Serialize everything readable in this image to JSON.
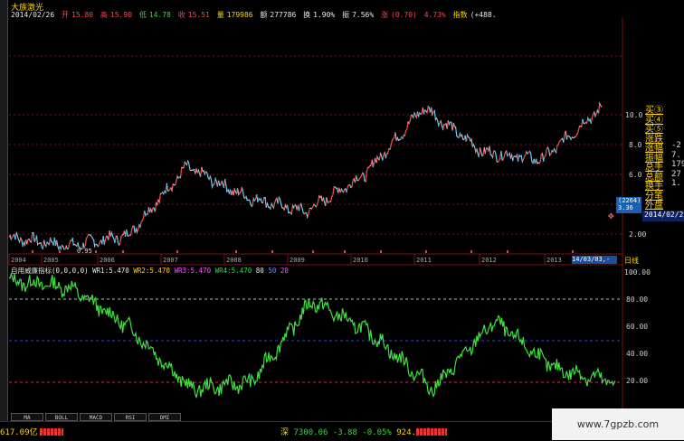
{
  "stock": {
    "name": "大族激光",
    "date": "2014/02/26",
    "open_label": "开",
    "open": "15.80",
    "high_label": "高",
    "high": "15.90",
    "low_label": "低",
    "low": "14.78",
    "close_label": "收",
    "close": "15.51",
    "volume_label": "量",
    "volume": "179986",
    "amount_label": "额",
    "amount": "277786",
    "turnover_label": "换",
    "turnover": "1.90%",
    "amplitude_label": "振",
    "amplitude": "7.56%",
    "change_label": "涨",
    "change": "(0.70)",
    "change_pct": "4.73%",
    "index_label": "指数",
    "index_val": "(+488."
  },
  "price_axis": [
    "10.00",
    "8.00",
    "6.00",
    "4.00",
    "2.00"
  ],
  "price_box": {
    "line1": "(2264)",
    "line2": "3.36"
  },
  "low_marker": "0.95",
  "years": [
    "2004",
    "2005",
    "2006",
    "2007",
    "2008",
    "2009",
    "2010",
    "2011",
    "2012",
    "2013"
  ],
  "date_cursor": "14/03/03,-",
  "period_label": "日线",
  "right_panel": {
    "items": [
      "买③",
      "买④",
      "买⑤",
      "涨跌",
      "涨幅",
      "振幅",
      "总手",
      "总额",
      "换手",
      "分笔",
      "外盘"
    ],
    "values": [
      "",
      "",
      "",
      "",
      "-2",
      "7.",
      "179",
      "27",
      "1.",
      "",
      ""
    ],
    "date": "2014/02/2"
  },
  "indicator": {
    "name": "自用威廉指标",
    "params": "(0,0,0,0)",
    "wr1": "WR1:5.470",
    "wr2": "WR2:5.470",
    "wr3": "WR3:5.470",
    "wr4": "WR4:5.470",
    "lv80": "80",
    "lv50": "50",
    "lv20": "20"
  },
  "osc_axis": [
    "100.00",
    "80.00",
    "60.00",
    "40.00",
    "20.00"
  ],
  "tabs": [
    "MA",
    "BOLL",
    "MACD",
    "RSI",
    "DMI"
  ],
  "status": {
    "left_amount": "617.09亿",
    "index_name": "深",
    "index_value": "7300.06",
    "index_change": "-3.88",
    "index_pct": "-0.05%",
    "index_amount": "924.92亿"
  },
  "watermark": "www.7gpzb.com",
  "chart_data": [
    {
      "type": "line",
      "title": "大族激光",
      "xlabel": "",
      "ylabel": "",
      "x": [
        "2004",
        "2005",
        "2006",
        "2007",
        "2008",
        "2009",
        "2010",
        "2011",
        "2012",
        "2013",
        "2014"
      ],
      "series": [
        {
          "values": [
            1.8,
            1.2,
            1.9,
            6.5,
            4.5,
            3.5,
            6.0,
            10.5,
            7.5,
            7.0,
            10.5
          ]
        }
      ]
    },
    {
      "type": "line",
      "title": "自用威廉指标",
      "xlabel": "",
      "ylabel": "",
      "ylim": [
        0,
        100
      ],
      "x": [
        "2004",
        "2005",
        "2006",
        "2007",
        "2008",
        "2009",
        "2010",
        "2011",
        "2012",
        "2013",
        "2014"
      ],
      "series": [
        {
          "name": "WR1",
          "values": [
            95,
            90,
            60,
            15,
            20,
            80,
            55,
            15,
            65,
            30,
            20
          ]
        }
      ]
    }
  ]
}
